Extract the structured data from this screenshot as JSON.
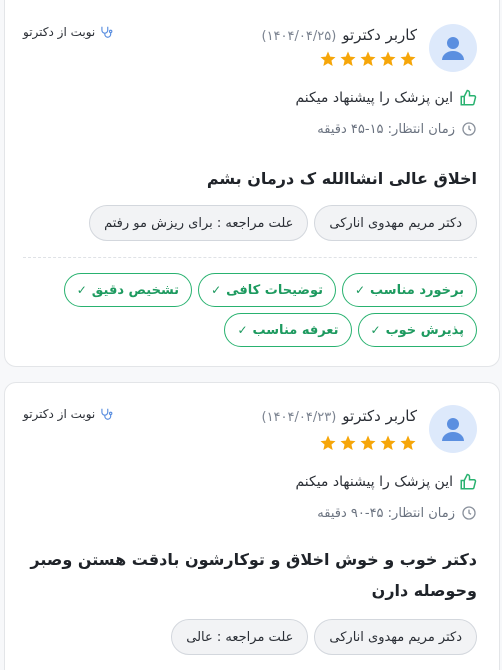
{
  "reviews": [
    {
      "username": "کاربر دکترتو",
      "date": "(۱۴۰۴/۰۴/۲۵)",
      "rating": 5,
      "nobat_label": "نوبت از دکترتو",
      "recommend_text": "این پزشک را پیشنهاد میکنم",
      "wait_text": "زمان انتظار: ۱۵-۴۵ دقیقه",
      "comment": "اخلاق عالی انشاالله ک درمان بشم",
      "tags": [
        "دکتر مریم مهدوی انارکی",
        "علت مراجعه : برای ریزش مو رفتم"
      ],
      "highlights": [
        "برخورد مناسب",
        "توضیحات کافی",
        "تشخیص دقیق",
        "پذیرش خوب",
        "تعرفه مناسب"
      ]
    },
    {
      "username": "کاربر دکترتو",
      "date": "(۱۴۰۴/۰۴/۲۳)",
      "rating": 5,
      "nobat_label": "نوبت از دکترتو",
      "recommend_text": "این پزشک را پیشنهاد میکنم",
      "wait_text": "زمان انتظار: ۴۵-۹۰ دقیقه",
      "comment": "دکتر خوب و خوش اخلاق و توکارشون بادقت هستن وصبر وحوصله دارن",
      "tags": [
        "دکتر مریم مهدوی انارکی",
        "علت مراجعه : عالی"
      ]
    }
  ],
  "colors": {
    "star": "#f6a609",
    "accent_green": "#1d9a5f",
    "avatar_bg": "#dde9fb",
    "avatar_fg": "#5b8fe0"
  },
  "icons": {
    "avatar": "user-avatar-icon",
    "star": "star-icon",
    "stethoscope": "stethoscope-icon",
    "thumbs_up": "thumbs-up-icon",
    "clock": "clock-icon",
    "check": "check-icon"
  }
}
